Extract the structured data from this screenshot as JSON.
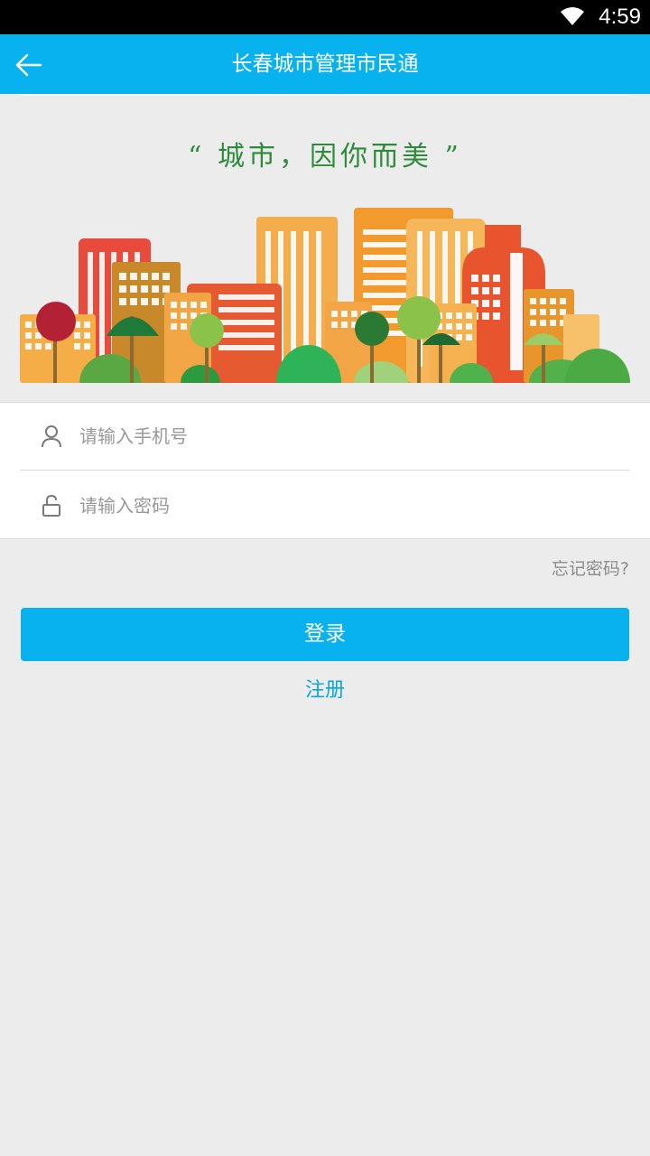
{
  "status_bar": {
    "time": "4:59"
  },
  "app_bar": {
    "title": "长春城市管理市民通",
    "back_icon": "arrow-left-icon"
  },
  "banner": {
    "slogan": "“ 城市，因你而美 ”"
  },
  "form": {
    "phone_placeholder": "请输入手机号",
    "phone_value": "",
    "password_placeholder": "请输入密码",
    "password_value": "",
    "phone_icon": "person-icon",
    "password_icon": "unlock-icon"
  },
  "forgot_password_label": "忘记密码?",
  "login_label": "登录",
  "register_label": "注册",
  "colors": {
    "primary": "#08b2ef",
    "slogan_green": "#2e8b3a",
    "background": "#ececec"
  }
}
